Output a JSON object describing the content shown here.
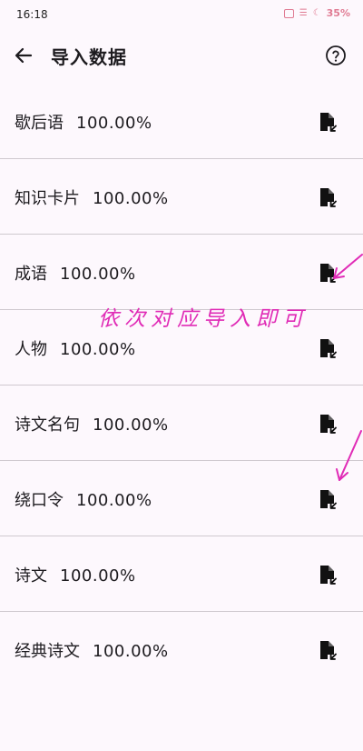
{
  "status_bar": {
    "time": "16:18",
    "icons": [
      "sim-icon",
      "signal-icon",
      "moon-icon"
    ],
    "battery": "35%",
    "accent_color": "#e07b93"
  },
  "app_bar": {
    "title": "导入数据",
    "back_icon": "arrow-left-icon",
    "help_icon": "help-circle-icon"
  },
  "items": [
    {
      "name": "歇后语",
      "percent": "100.00%"
    },
    {
      "name": "知识卡片",
      "percent": "100.00%"
    },
    {
      "name": "成语",
      "percent": "100.00%"
    },
    {
      "name": "人物",
      "percent": "100.00%"
    },
    {
      "name": "诗文名句",
      "percent": "100.00%"
    },
    {
      "name": "绕口令",
      "percent": "100.00%"
    },
    {
      "name": "诗文",
      "percent": "100.00%"
    },
    {
      "name": "经典诗文",
      "percent": "100.00%"
    }
  ],
  "item_action_icon": "file-import-icon",
  "annotation": {
    "text": "依次对应导入即可",
    "color": "#e02bb6"
  }
}
